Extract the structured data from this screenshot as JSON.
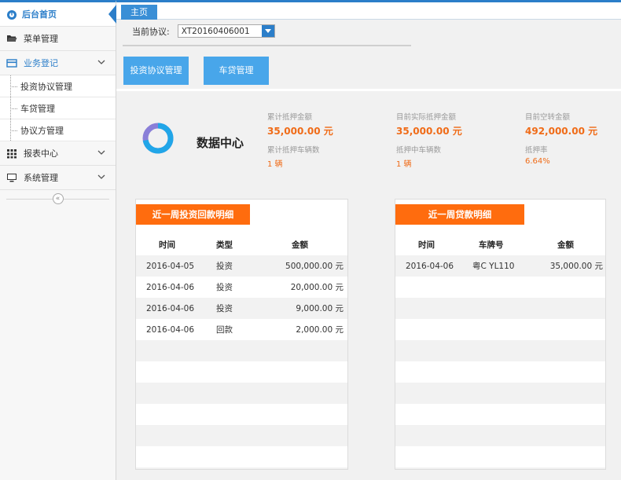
{
  "sidebar": {
    "home": "后台首页",
    "menu_mgmt": "菜单管理",
    "business": "业务登记",
    "sub_items": [
      "投资协议管理",
      "车贷管理",
      "协议方管理"
    ],
    "reports": "报表中心",
    "system": "系统管理",
    "collapse": "«"
  },
  "tabs": [
    "主页"
  ],
  "protocol": {
    "label": "当前协议:",
    "value": "XT20160406001"
  },
  "buttons": {
    "invest": "投资协议管理",
    "car_loan": "车贷管理"
  },
  "data_center": {
    "title": "数据中心",
    "stats": [
      {
        "label": "累计抵押金额",
        "value": "35,000.00 元"
      },
      {
        "label": "累计抵押车辆数",
        "value": "1 辆"
      },
      {
        "label": "目前实际抵押金额",
        "value": "35,000.00 元"
      },
      {
        "label": "抵押中车辆数",
        "value": "1 辆"
      },
      {
        "label": "目前空转金额",
        "value": "492,000.00 元"
      },
      {
        "label": "抵押率",
        "value": "6.64%"
      }
    ]
  },
  "invest_panel": {
    "title": "近一周投资回款明细",
    "headers": [
      "时间",
      "类型",
      "金额"
    ],
    "rows": [
      [
        "2016-04-05",
        "投资",
        "500,000.00 元"
      ],
      [
        "2016-04-06",
        "投资",
        "20,000.00 元"
      ],
      [
        "2016-04-06",
        "投资",
        "9,000.00 元"
      ],
      [
        "2016-04-06",
        "回款",
        "2,000.00 元"
      ]
    ]
  },
  "loan_panel": {
    "title": "近一周贷款明细",
    "headers": [
      "时间",
      "车牌号",
      "金额"
    ],
    "rows": [
      [
        "2016-04-06",
        "粤C YL110",
        "35,000.00 元"
      ]
    ]
  },
  "colors": {
    "accent": "#2b7ec9",
    "button": "#48a6ea",
    "orange": "#ff6c0e",
    "value": "#f06b17"
  }
}
